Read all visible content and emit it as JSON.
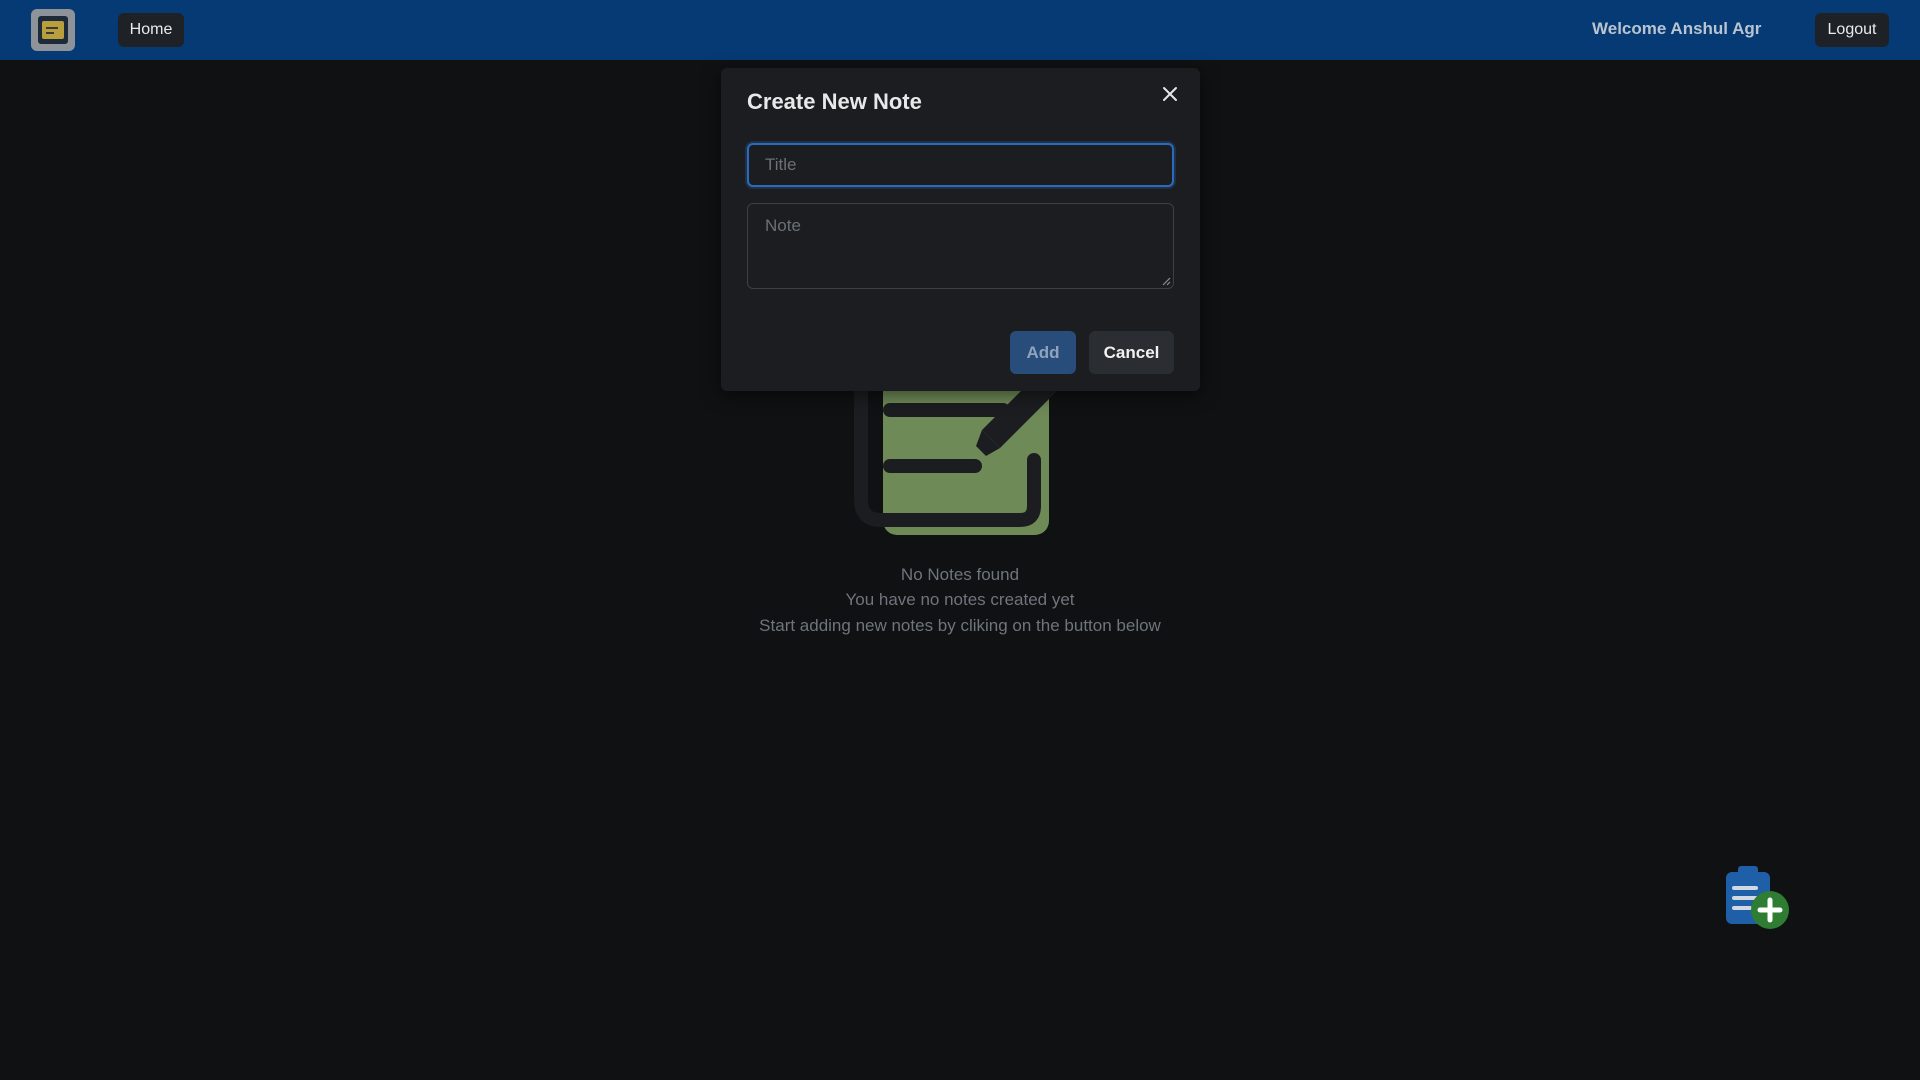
{
  "navbar": {
    "home_label": "Home",
    "welcome_text": "Welcome Anshul Agr",
    "logout_label": "Logout"
  },
  "empty_state": {
    "line1": "No Notes found",
    "line2": "You have no notes created yet",
    "line3": "Start adding new notes by cliking on the button below"
  },
  "modal": {
    "title": "Create New Note",
    "title_input": {
      "value": "",
      "placeholder": "Title"
    },
    "note_input": {
      "value": "",
      "placeholder": "Note"
    },
    "add_label": "Add",
    "cancel_label": "Cancel"
  },
  "icons": {
    "logo": "notes-app-logo-icon",
    "close": "close-icon",
    "empty": "note-pencil-illustration-icon",
    "fab": "add-note-icon"
  },
  "colors": {
    "navbar": "#063a74",
    "background": "#0f1112",
    "modal": "#1b1d20",
    "focus_border": "#2b6bbd",
    "add_button": "#284d7a",
    "illustration_green": "#6e8a57",
    "fab_plus_green": "#2e7d32"
  }
}
